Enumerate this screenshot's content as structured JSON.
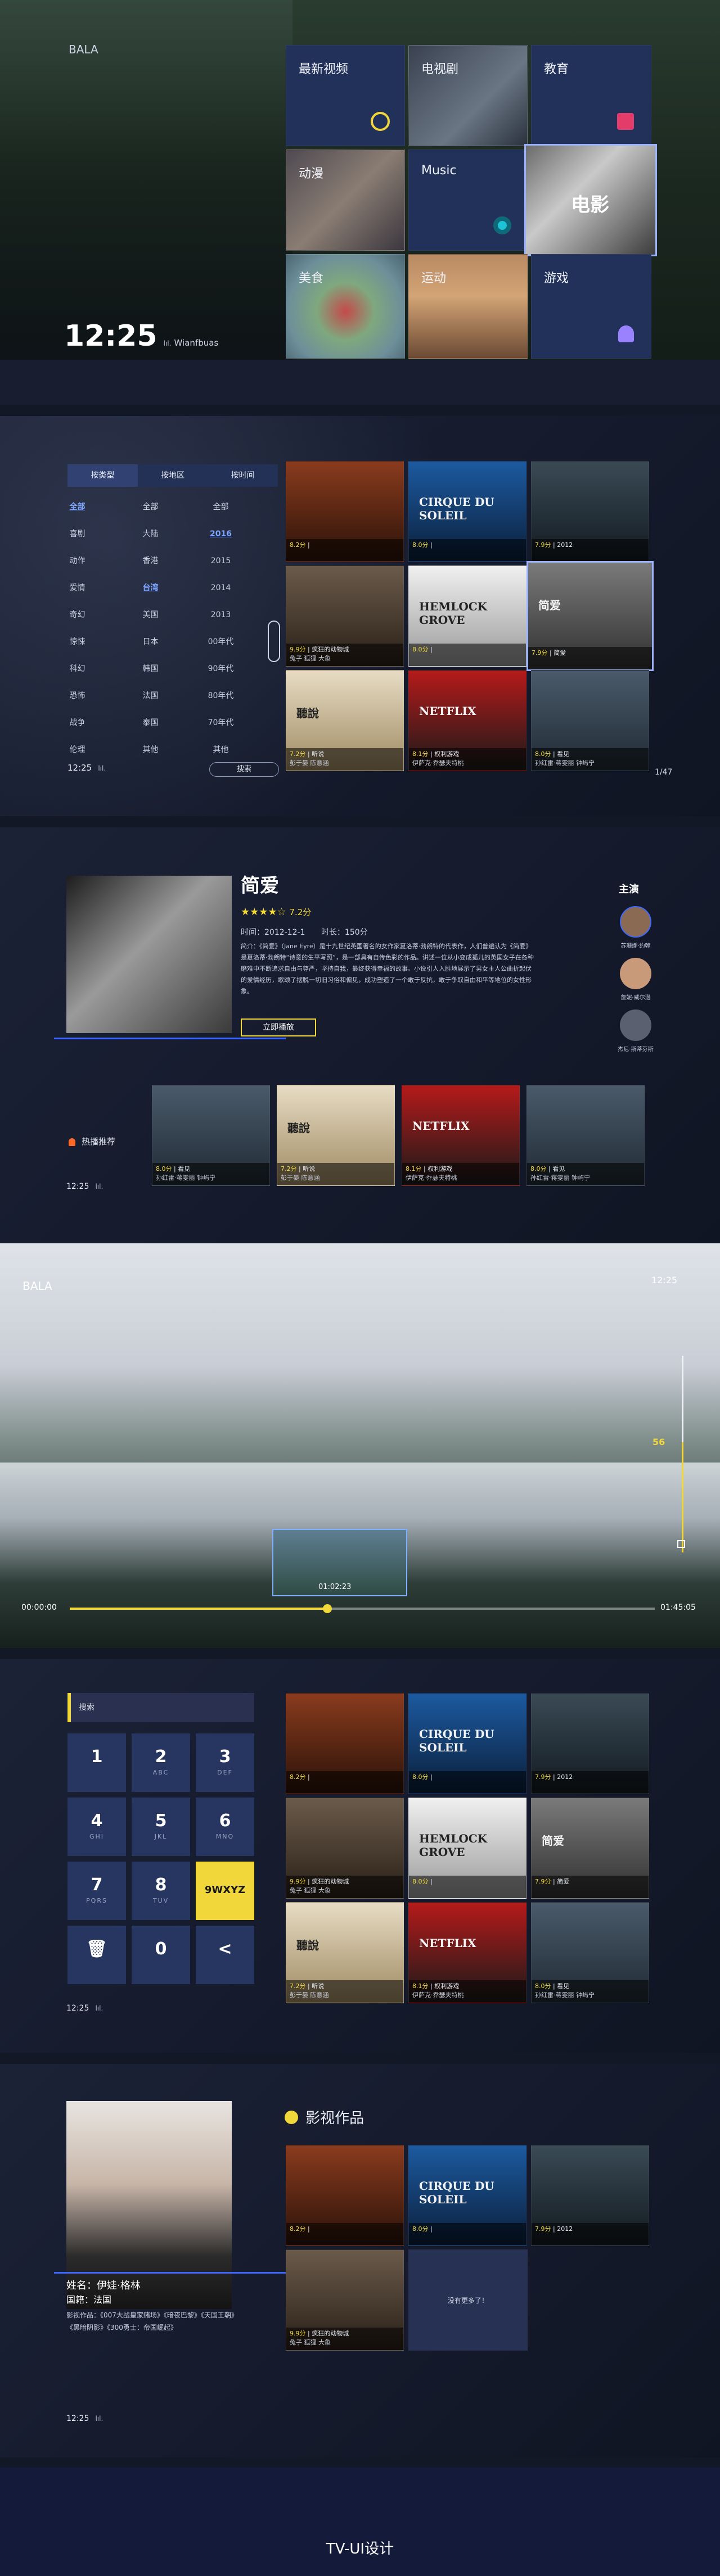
{
  "brand": "BALA",
  "home": {
    "time": "12:25",
    "wifi": "lıl.",
    "date": "Wianfbuas",
    "tiles": [
      {
        "label": "最新视频"
      },
      {
        "label": "电视剧"
      },
      {
        "label": "教育"
      },
      {
        "label": "动漫"
      },
      {
        "label": "Music"
      },
      {
        "label": "电影"
      },
      {
        "label": "美食"
      },
      {
        "label": "运动"
      },
      {
        "label": "游戏"
      }
    ]
  },
  "filter": {
    "tabs": [
      "按类型",
      "按地区",
      "按时间"
    ],
    "types": [
      "全部",
      "喜剧",
      "动作",
      "爱情",
      "奇幻",
      "惊悚",
      "科幻",
      "恐怖",
      "战争",
      "伦理"
    ],
    "regions": [
      "全部",
      "大陆",
      "香港",
      "台湾",
      "美国",
      "日本",
      "韩国",
      "法国",
      "泰国",
      "其他"
    ],
    "years": [
      "全部",
      "2016",
      "2015",
      "2014",
      "2013",
      "00年代",
      "90年代",
      "80年代",
      "70年代",
      "其他"
    ],
    "search": "搜索",
    "page": "1/47",
    "time": "12:25",
    "wifi": "lıl."
  },
  "posters": [
    {
      "id": "p1",
      "score": "8.2分",
      "meta": "|",
      "l2": "",
      "t": ""
    },
    {
      "id": "p2",
      "score": "8.0分",
      "meta": "|",
      "l2": "",
      "t": "CIRQUE DU SOLEIL"
    },
    {
      "id": "p3",
      "score": "7.9分",
      "meta": "| 2012",
      "l2": "",
      "t": ""
    },
    {
      "id": "p4",
      "score": "9.9分",
      "meta": "| 疯狂的动物城",
      "l2": "兔子 狐狸 大象",
      "t": ""
    },
    {
      "id": "p5",
      "score": "8.0分",
      "meta": "|",
      "l2": "",
      "t": "HEMLOCK GROVE"
    },
    {
      "id": "p6",
      "score": "7.9分",
      "meta": "| 简爱",
      "l2": "",
      "t": "简爱"
    },
    {
      "id": "p7",
      "score": "7.2分",
      "meta": "| 听说",
      "l2": "彭于晏 陈意涵",
      "t": "聽說"
    },
    {
      "id": "p8",
      "score": "8.1分",
      "meta": "| 权利游戏",
      "l2": "伊萨克·乔瑟夫特桃",
      "t": "NETFLIX"
    },
    {
      "id": "p9",
      "score": "8.0分",
      "meta": "| 看见",
      "l2": "孙红雷·蒋雯丽 钟屿宁",
      "t": ""
    }
  ],
  "detail": {
    "title": "简爱",
    "stars": "★★★★☆",
    "score": "7.2分",
    "date": "时间：2012-12-1",
    "duration": "时长：150分",
    "desc": "简介：《简爱》（Jane Eyre）是十九世纪英国著名的女作家夏洛蒂·勃朗特的代表作，人们普遍认为《简爱》是夏洛蒂·勃朗特“诗意的生平写照”，是一部具有自传色彩的作品。讲述一位从小变成孤儿的英国女子在各种磨难中不断追求自由与尊严，坚持自我，最终获得幸福的故事。小说引人入胜地展示了男女主人公曲折起伏的爱情经历，歌颂了摆脱一切旧习俗和偏见，成功塑造了一个敢于反抗，敢于争取自由和平等地位的女性形象。",
    "play": "立即播放",
    "cast_title": "主演",
    "cast": [
      "苏珊娜·约翰",
      "詹妮·威尔逊",
      "杰尼·斯蒂芬斯"
    ],
    "hot": "热播推荐",
    "time": "12:25",
    "wifi": "lıl."
  },
  "player": {
    "brand": "BALA",
    "time": "12:25",
    "current": "00:00:00",
    "preview_time": "01:02:23",
    "total": "01:45:05",
    "volume": "56",
    "progress": 0.44,
    "volume_level": 0.56
  },
  "search": {
    "label": "搜索",
    "keys": [
      {
        "n": "1",
        "s": ""
      },
      {
        "n": "2",
        "s": "ABC"
      },
      {
        "n": "3",
        "s": "DEF"
      },
      {
        "n": "4",
        "s": "GHI"
      },
      {
        "n": "5",
        "s": "JKL"
      },
      {
        "n": "6",
        "s": "MNO"
      },
      {
        "n": "7",
        "s": "PQRS"
      },
      {
        "n": "8",
        "s": "TUV"
      },
      {
        "n": "9WXYZ",
        "s": ""
      },
      {
        "n": "🗑",
        "s": ""
      },
      {
        "n": "0",
        "s": ""
      },
      {
        "n": "<",
        "s": ""
      }
    ],
    "time": "12:25",
    "wifi": "lıl."
  },
  "actor": {
    "name": "姓名：伊娃·格林",
    "nation": "国籍：法国",
    "works": "影视作品：《007大战皇家赌场》《暗夜巴黎》《天国王朝》《黑暗阴影》《300勇士：帝国崛起》",
    "section": "影视作品",
    "more": "没有更多了！",
    "time": "12:25",
    "wifi": "lıl."
  },
  "footer": "TV-UI设计"
}
